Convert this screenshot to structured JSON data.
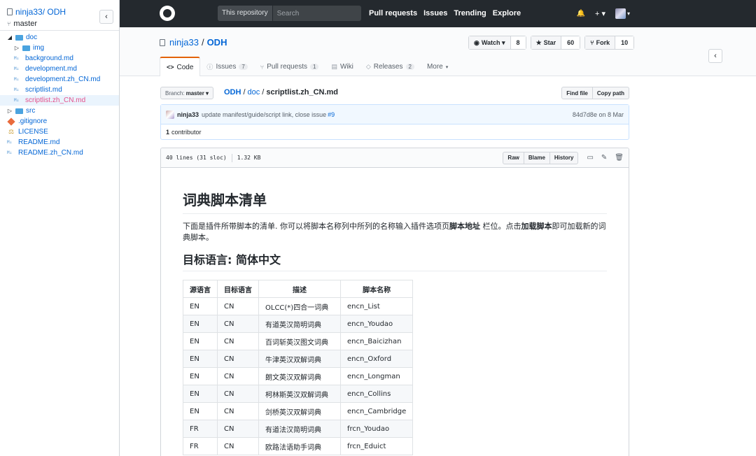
{
  "sidebar": {
    "repo": "ninja33/ ODH",
    "branch": "master",
    "toggle": "‹",
    "tree": [
      {
        "label": "doc",
        "type": "folder",
        "open": true,
        "depth": 0
      },
      {
        "label": "img",
        "type": "folder",
        "open": false,
        "depth": 1
      },
      {
        "label": "background.md",
        "type": "md",
        "depth": 1
      },
      {
        "label": "development.md",
        "type": "md",
        "depth": 1
      },
      {
        "label": "development.zh_CN.md",
        "type": "md",
        "depth": 1
      },
      {
        "label": "scriptlist.md",
        "type": "md",
        "depth": 1
      },
      {
        "label": "scriptlist.zh_CN.md",
        "type": "md",
        "depth": 1,
        "selected": true
      },
      {
        "label": "src",
        "type": "folder",
        "open": false,
        "depth": 0
      },
      {
        "label": ".gitignore",
        "type": "git",
        "depth": 0
      },
      {
        "label": "LICENSE",
        "type": "license",
        "depth": 0
      },
      {
        "label": "README.md",
        "type": "md",
        "depth": 0
      },
      {
        "label": "README.zh_CN.md",
        "type": "md",
        "depth": 0
      }
    ]
  },
  "header": {
    "scope": "This repository",
    "search_placeholder": "Search",
    "nav": [
      "Pull requests",
      "Issues",
      "Trending",
      "Explore"
    ],
    "bell": "🔔",
    "plus": "+ ▾",
    "avatar_caret": "▾"
  },
  "repo": {
    "owner": "ninja33",
    "sep": "/",
    "name": "ODH",
    "watch": {
      "label": "Watch ▾",
      "count": "8"
    },
    "star": {
      "label": "Star",
      "count": "60"
    },
    "fork": {
      "label": "Fork",
      "count": "10"
    },
    "toggle": "‹",
    "tabs": [
      {
        "label": "Code",
        "icon": "<>",
        "badge": ""
      },
      {
        "label": "Issues",
        "icon": "ⓘ",
        "badge": "7"
      },
      {
        "label": "Pull requests",
        "icon": "⑂",
        "badge": "1"
      },
      {
        "label": "Wiki",
        "icon": "▤",
        "badge": ""
      },
      {
        "label": "Releases",
        "icon": "◇",
        "badge": "2"
      },
      {
        "label": "More",
        "icon": "",
        "badge": ""
      }
    ],
    "more_caret": "▾"
  },
  "path": {
    "branch_label": "Branch:",
    "branch": "master ▾",
    "repo": "ODH",
    "dir": "doc",
    "file": "scriptlist.zh_CN.md",
    "find": "Find file",
    "copy": "Copy path"
  },
  "commit": {
    "author": "ninja33",
    "message": "update manifest/guide/script link, close issue",
    "issue": "#9",
    "sha": "84d7d8e",
    "on": "on 8 Mar",
    "contrib_count": "1",
    "contrib_label": "contributor"
  },
  "file": {
    "lines": "40 lines (31 sloc)",
    "size": "1.32 KB",
    "raw": "Raw",
    "blame": "Blame",
    "history": "History"
  },
  "content": {
    "h1": "词典脚本清单",
    "p_part1": "下面是插件所带脚本的清单. 你可以将脚本名称列中所列的名称输入插件选项页",
    "p_bold1": "脚本地址",
    "p_part2": " 栏位。点击",
    "p_bold2": "加载脚本",
    "p_part3": "即可加载新的词典脚本。",
    "h2": "目标语言: 简体中文",
    "headers": [
      "源语言",
      "目标语言",
      "描述",
      "脚本名称"
    ],
    "rows": [
      [
        "EN",
        "CN",
        "OLCC(*)四合一词典",
        "encn_List"
      ],
      [
        "EN",
        "CN",
        "有道英汉简明词典",
        "encn_Youdao"
      ],
      [
        "EN",
        "CN",
        "百词斩英汉图文词典",
        "encn_Baicizhan"
      ],
      [
        "EN",
        "CN",
        "牛津英汉双解词典",
        "encn_Oxford"
      ],
      [
        "EN",
        "CN",
        "朗文英汉双解词典",
        "encn_Longman"
      ],
      [
        "EN",
        "CN",
        "柯林斯英汉双解词典",
        "encn_Collins"
      ],
      [
        "EN",
        "CN",
        "剑桥英汉双解词典",
        "encn_Cambridge"
      ],
      [
        "FR",
        "CN",
        "有道法汉简明词典",
        "frcn_Youdao"
      ],
      [
        "FR",
        "CN",
        "欧路法语助手词典",
        "frcn_Eduict"
      ]
    ]
  }
}
